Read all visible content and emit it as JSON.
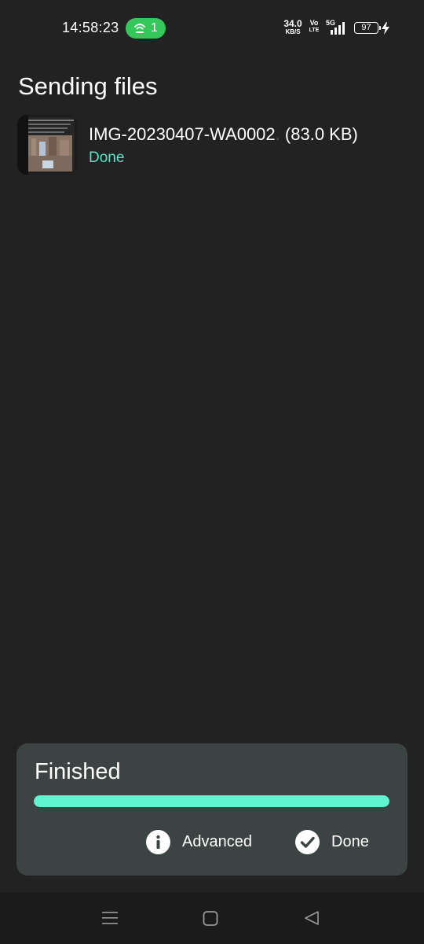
{
  "status_bar": {
    "time": "14:58:23",
    "hotspot_count": "1",
    "net_speed_value": "34.0",
    "net_speed_unit": "KB/S",
    "volte_top": "Vo",
    "volte_bottom": "LTE",
    "network_type": "5G",
    "battery_level": "97",
    "icons": [
      "hotspot-icon",
      "signal-icon",
      "battery-icon",
      "charging-icon"
    ]
  },
  "page": {
    "title": "Sending files"
  },
  "files": [
    {
      "name": "IMG-20230407-WA0002",
      "ellipsis": ".",
      "size": "(83.0 KB)",
      "status": "Done"
    }
  ],
  "panel": {
    "title": "Finished",
    "progress": 1.0,
    "advanced_label": "Advanced",
    "done_label": "Done",
    "icons": [
      "info-icon",
      "check-circle-icon"
    ]
  },
  "nav": {
    "icons": [
      "menu-icon",
      "home-icon",
      "back-icon"
    ]
  },
  "colors": {
    "background": "#222222",
    "accent": "#5ff5d0",
    "status_text": "#52e8c5",
    "panel": "#3c4443",
    "hotspot": "#34c759"
  }
}
